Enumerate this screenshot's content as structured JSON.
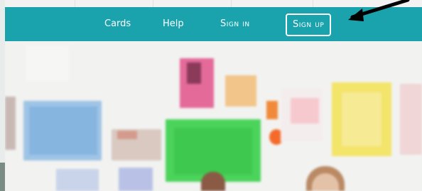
{
  "nav": {
    "cards_label": "Cards",
    "help_label": "Help",
    "signin_label": "Sign in",
    "signup_label": "Sign up"
  },
  "colors": {
    "nav_background": "#1aa2ad",
    "nav_text": "#ffffff",
    "annotation_arrow": "#000000"
  },
  "hero": {
    "image_description_icon": "classroom-wall-photo"
  }
}
